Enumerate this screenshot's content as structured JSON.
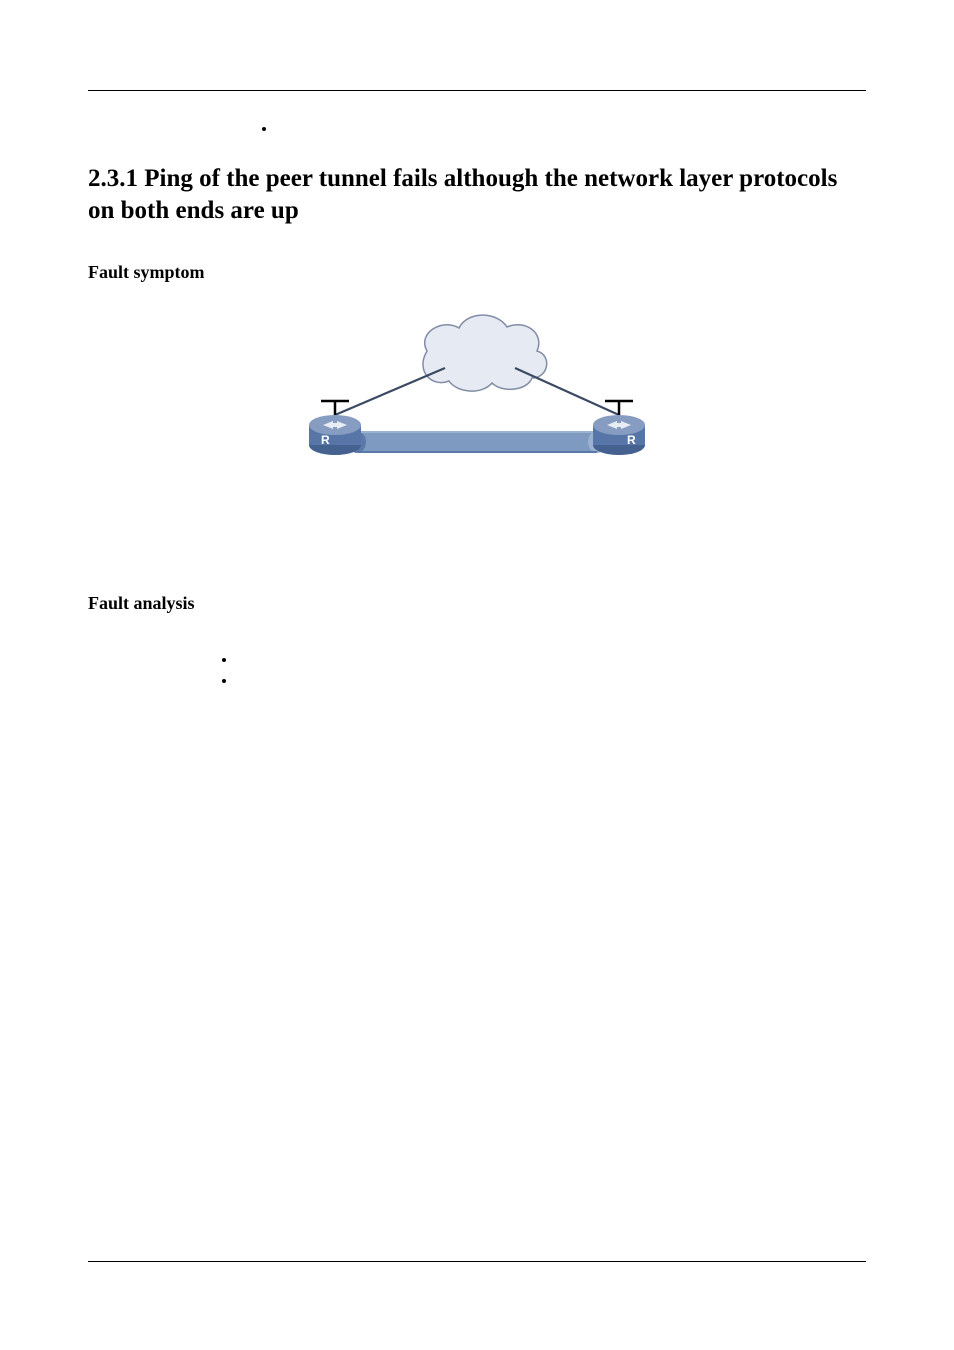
{
  "section": {
    "number": "2.3.1",
    "title": "2.3.1 Ping of the peer tunnel fails although the network layer protocols on both ends are up"
  },
  "headings": {
    "fault_symptom": "Fault symptom",
    "fault_analysis": "Fault analysis"
  },
  "top_bullets": [
    ""
  ],
  "analysis_bullets": [
    "",
    ""
  ],
  "diagram": {
    "router_label": "R",
    "colors": {
      "router_body": "#5776a7",
      "router_top": "#869cc0",
      "cloud_fill": "#e6eaf2",
      "cloud_stroke": "#818da6",
      "tunnel_fill": "#7f9ac1",
      "tunnel_end": "#5b79a8",
      "line": "#3a4a63"
    }
  }
}
